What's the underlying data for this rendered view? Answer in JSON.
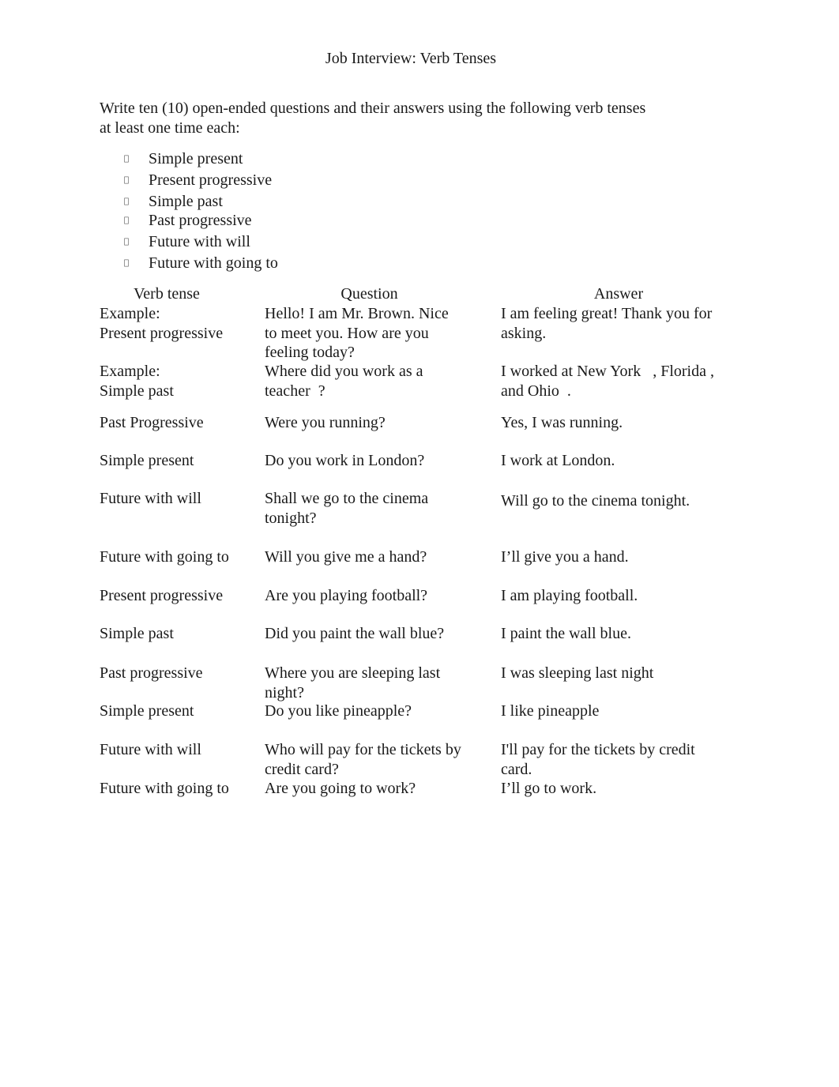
{
  "document": {
    "title": "Job Interview: Verb Tenses",
    "instructions": [
      "Write ten (10) open-ended questions and their answers using the following verb tenses",
      "at least one time each:"
    ],
    "bullet_icon": "missing-glyph-box",
    "bullets": [
      "Simple present",
      "Present progressive",
      "Simple past",
      "Past progressive",
      "Future with will",
      "Future with going to"
    ],
    "table": {
      "headers": [
        "Verb tense",
        "Question",
        "Answer"
      ],
      "rows": [
        {
          "tense": [
            "Example:",
            "Present progressive"
          ],
          "question": [
            "Hello! I am Mr. Brown. Nice",
            "to meet you. How are you",
            "feeling today?"
          ],
          "answer": [
            "I am feeling great! Thank you for",
            "asking."
          ]
        },
        {
          "tense": [
            "Example:",
            "Simple past"
          ],
          "question": [
            "Where did you work as a",
            "teacher  ?"
          ],
          "answer": [
            "I worked at New York   , Florida ,",
            "and Ohio  ."
          ]
        },
        {
          "tense": [
            "Past Progressive"
          ],
          "question": [
            "Were you running?"
          ],
          "answer": [
            "Yes, I was running."
          ]
        },
        {
          "tense": [
            "Simple present"
          ],
          "question": [
            "Do you work in London?"
          ],
          "answer": [
            "I work at London."
          ]
        },
        {
          "tense": [
            "Future with will"
          ],
          "question": [
            "Shall we go to the cinema",
            "tonight?"
          ],
          "answer": [
            "Will go to the cinema tonight."
          ]
        },
        {
          "tense": [
            "Future with going to"
          ],
          "question": [
            "Will you give me a hand?"
          ],
          "answer": [
            "I’ll give you a hand."
          ]
        },
        {
          "tense": [
            "Present progressive"
          ],
          "question": [
            "Are you playing football?"
          ],
          "answer": [
            "I am playing football."
          ]
        },
        {
          "tense": [
            "Simple past"
          ],
          "question": [
            "Did you paint the wall blue?"
          ],
          "answer": [
            "I paint the wall blue."
          ]
        },
        {
          "tense": [
            "Past progressive"
          ],
          "question": [
            "Where you are sleeping last",
            "night?"
          ],
          "answer": [
            "I was sleeping last night"
          ]
        },
        {
          "tense": [
            "Simple present"
          ],
          "question": [
            "Do you like pineapple?"
          ],
          "answer": [
            "I like pineapple"
          ]
        },
        {
          "tense": [
            "Future with will"
          ],
          "question": [
            "Who will pay for the tickets by",
            "credit card?"
          ],
          "answer": [
            "I'll pay for the tickets by credit",
            "card."
          ]
        },
        {
          "tense": [
            "Future with going to"
          ],
          "question": [
            "Are you going to work?"
          ],
          "answer": [
            "I’ll go to work."
          ]
        }
      ]
    }
  }
}
